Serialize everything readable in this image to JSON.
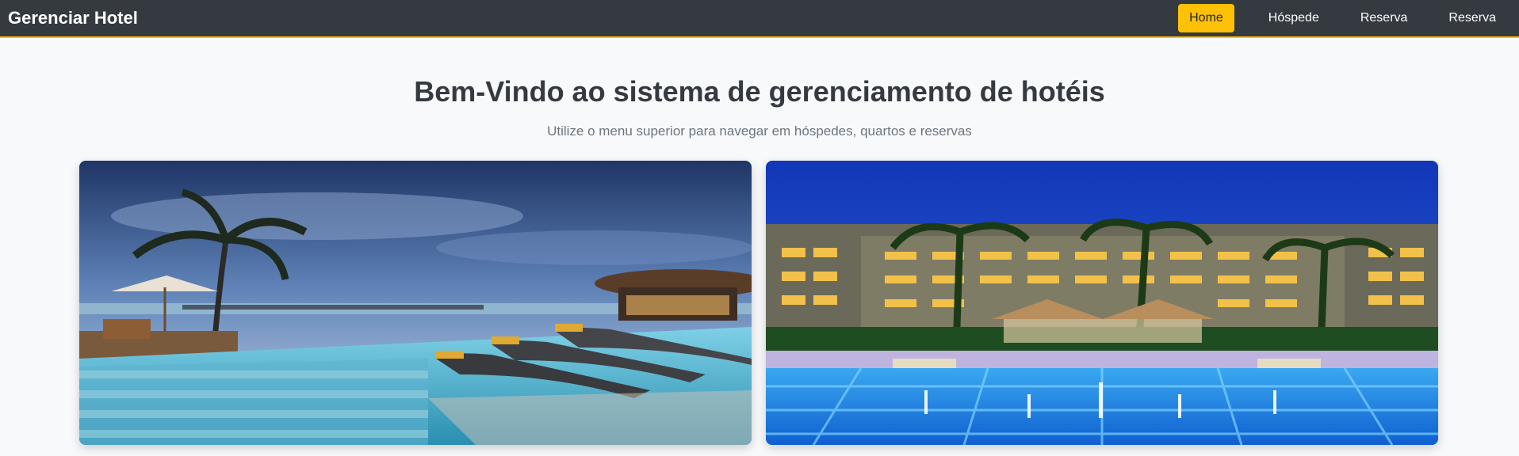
{
  "navbar": {
    "brand": "Gerenciar Hotel",
    "links": [
      {
        "label": "Home",
        "active": true
      },
      {
        "label": "Hóspede",
        "active": false
      },
      {
        "label": "Reserva",
        "active": false
      },
      {
        "label": "Reserva",
        "active": false
      }
    ]
  },
  "main": {
    "title": "Bem-Vindo ao sistema de gerenciamento de hotéis",
    "subtitle": "Utilize o menu superior para navegar em hóspedes, quartos e reservas"
  },
  "colors": {
    "navbar_bg": "#343a40",
    "accent": "#ffc107",
    "page_bg": "#f8f9fa"
  }
}
